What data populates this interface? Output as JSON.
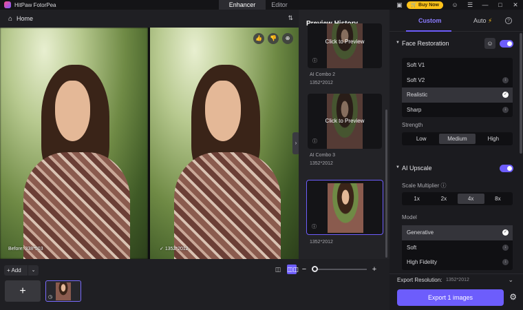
{
  "titlebar": {
    "app_name": "HitPaw FotorPea",
    "tabs": [
      "Enhancer",
      "Editor"
    ],
    "buy_label": "Buy Now"
  },
  "header": {
    "home_label": "Home"
  },
  "canvas": {
    "before_caption": "Before: 338*503",
    "after_caption": "1352*2012"
  },
  "bottom": {
    "add_label": "Add",
    "add_tile": "+",
    "zoom_level": 0.05
  },
  "history": {
    "title": "Preview History",
    "cards": [
      {
        "overlay": "Click to Preview",
        "name": "AI Combo 2",
        "size": "1352*2012"
      },
      {
        "overlay": "Click to Preview",
        "name": "AI Combo 3",
        "size": "1352*2012"
      },
      {
        "overlay": "",
        "name": "",
        "size": "1352*2012"
      }
    ]
  },
  "panel": {
    "tabs": [
      "Custom",
      "Auto"
    ],
    "face_restoration": {
      "title": "Face Restoration",
      "options": [
        "Soft V1",
        "Soft V2",
        "Realistic",
        "Sharp"
      ],
      "selected": "Realistic",
      "strength_label": "Strength",
      "strength_options": [
        "Low",
        "Medium",
        "High"
      ],
      "strength_selected": "Medium"
    },
    "ai_upscale": {
      "title": "AI Upscale",
      "scale_label": "Scale Multiplier",
      "scale_options": [
        "1x",
        "2x",
        "4x",
        "8x"
      ],
      "scale_selected": "4x",
      "model_label": "Model",
      "models": [
        "Generative",
        "Soft",
        "High Fidelity"
      ],
      "model_selected": "Generative"
    },
    "export_resolution_label": "Export Resolution:",
    "export_resolution_value": "1352*2012",
    "export_button": "Export 1 images"
  },
  "colors": {
    "accent": "#6d5dfc",
    "buy": "#ffc21a"
  }
}
